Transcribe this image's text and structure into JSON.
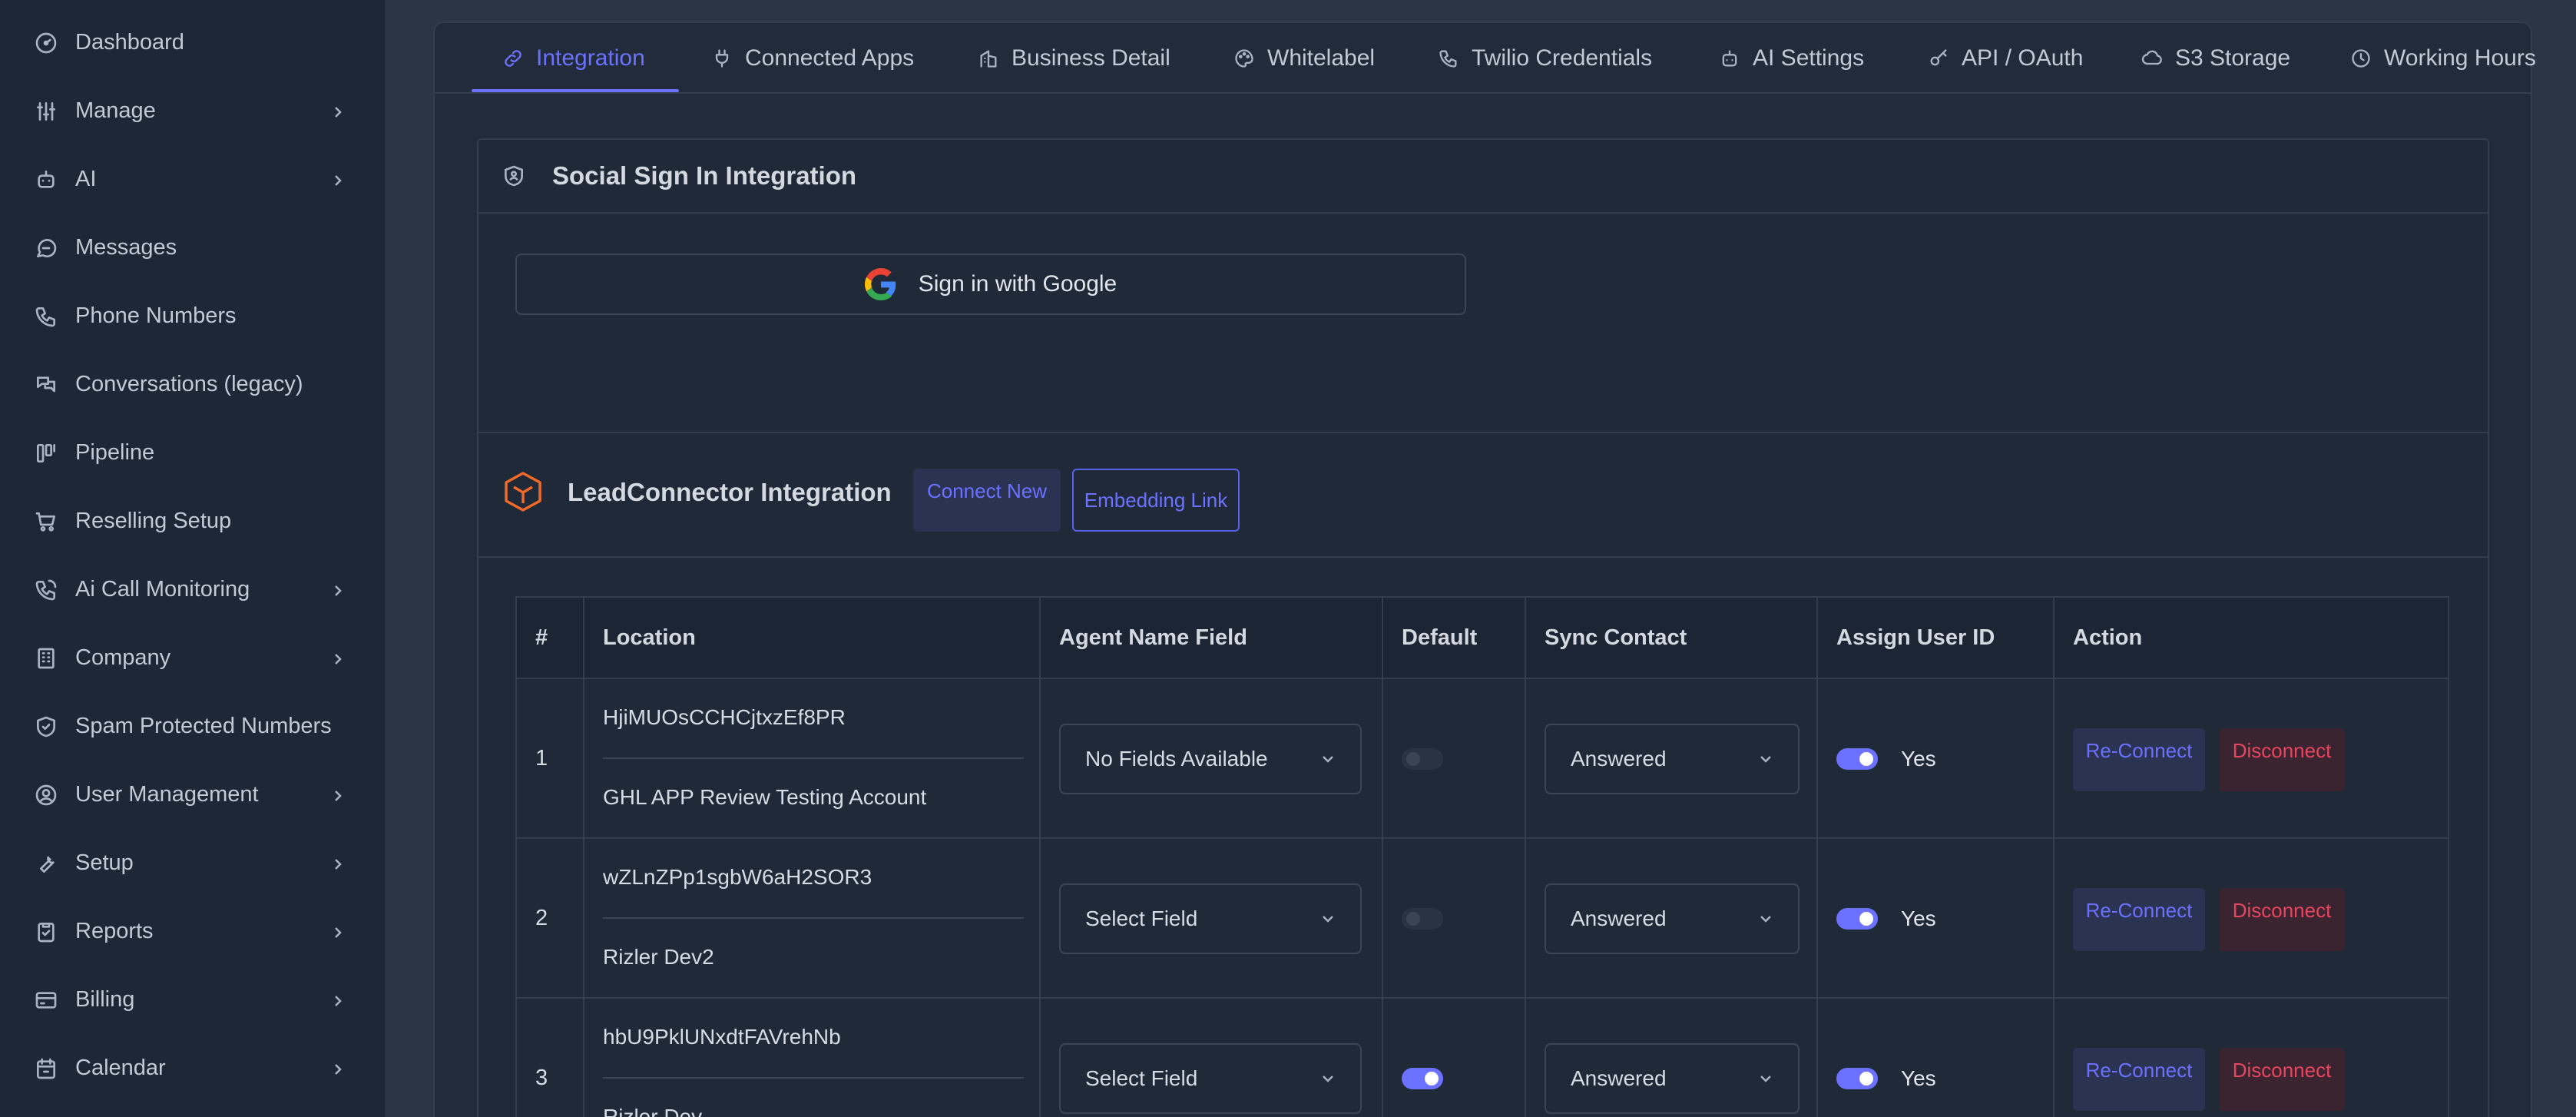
{
  "sidebar": {
    "items": [
      {
        "label": "Dashboard",
        "icon": "dashboard-icon",
        "has_chevron": false
      },
      {
        "label": "Manage",
        "icon": "sliders-icon",
        "has_chevron": true
      },
      {
        "label": "AI",
        "icon": "robot-icon",
        "has_chevron": true
      },
      {
        "label": "Messages",
        "icon": "message-icon",
        "has_chevron": false
      },
      {
        "label": "Phone Numbers",
        "icon": "phone-icon",
        "has_chevron": false
      },
      {
        "label": "Conversations (legacy)",
        "icon": "chat-icon",
        "has_chevron": false
      },
      {
        "label": "Pipeline",
        "icon": "pipeline-icon",
        "has_chevron": false
      },
      {
        "label": "Reselling Setup",
        "icon": "cart-icon",
        "has_chevron": false
      },
      {
        "label": "Ai Call Monitoring",
        "icon": "phone-call-icon",
        "has_chevron": true
      },
      {
        "label": "Company",
        "icon": "building-icon",
        "has_chevron": true
      },
      {
        "label": "Spam Protected Numbers",
        "icon": "shield-icon",
        "has_chevron": false
      },
      {
        "label": "User Management",
        "icon": "user-circle-icon",
        "has_chevron": true
      },
      {
        "label": "Setup",
        "icon": "wrench-icon",
        "has_chevron": true
      },
      {
        "label": "Reports",
        "icon": "clipboard-icon",
        "has_chevron": true
      },
      {
        "label": "Billing",
        "icon": "credit-card-icon",
        "has_chevron": true
      },
      {
        "label": "Calendar",
        "icon": "calendar-icon",
        "has_chevron": true
      }
    ]
  },
  "tabs": [
    {
      "label": "Integration",
      "icon": "link-icon",
      "active": true
    },
    {
      "label": "Connected Apps",
      "icon": "plug-icon",
      "active": false
    },
    {
      "label": "Business Detail",
      "icon": "building-icon",
      "active": false
    },
    {
      "label": "Whitelabel",
      "icon": "palette-icon",
      "active": false
    },
    {
      "label": "Twilio Credentials",
      "icon": "phone-icon",
      "active": false
    },
    {
      "label": "AI Settings",
      "icon": "robot-icon",
      "active": false
    },
    {
      "label": "API / OAuth",
      "icon": "key-icon",
      "active": false
    },
    {
      "label": "S3 Storage",
      "icon": "cloud-icon",
      "active": false
    },
    {
      "label": "Working Hours",
      "icon": "clock-icon",
      "active": false
    }
  ],
  "social": {
    "title": "Social Sign In Integration",
    "google_label": "Sign in with Google"
  },
  "leadconnector": {
    "title": "LeadConnector Integration",
    "connect_new": "Connect New",
    "embedding_link": "Embedding Link"
  },
  "table": {
    "headers": [
      "#",
      "Location",
      "Agent Name Field",
      "Default",
      "Sync Contact",
      "Assign User ID",
      "Action"
    ],
    "rows": [
      {
        "num": "1",
        "location_id": "HjiMUOsCCHCjtxzEf8PR",
        "location_name": "GHL APP Review Testing Account",
        "agent_field": "No Fields Available",
        "default_on": false,
        "sync": "Answered",
        "assign_on": true,
        "assign_label": "Yes",
        "reconnect": "Re-Connect",
        "disconnect": "Disconnect"
      },
      {
        "num": "2",
        "location_id": "wZLnZPp1sgbW6aH2SOR3",
        "location_name": "Rizler Dev2",
        "agent_field": "Select Field",
        "default_on": false,
        "sync": "Answered",
        "assign_on": true,
        "assign_label": "Yes",
        "reconnect": "Re-Connect",
        "disconnect": "Disconnect"
      },
      {
        "num": "3",
        "location_id": "hbU9PklUNxdtFAVrehNb",
        "location_name": "Rizler Dev",
        "agent_field": "Select Field",
        "default_on": true,
        "sync": "Answered",
        "assign_on": true,
        "assign_label": "Yes",
        "reconnect": "Re-Connect",
        "disconnect": "Disconnect"
      }
    ]
  },
  "colors": {
    "accent": "#6c72ff",
    "danger": "#e8455f",
    "sidebar_bg": "#1e2736",
    "panel_bg": "#212b3a"
  }
}
